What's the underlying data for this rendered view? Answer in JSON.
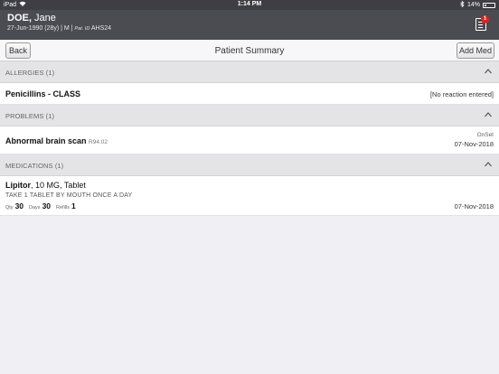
{
  "status_bar": {
    "carrier": "iPad",
    "time": "1:14 PM",
    "battery": "14%",
    "wifi_icon": "wifi-icon",
    "bluetooth_icon": "bluetooth-icon"
  },
  "patient": {
    "last_name": "DOE,",
    "first_name": "Jane",
    "dob_age": "27-Jun-1990 (28y)",
    "sex": "M",
    "pat_id_label": "Pat. ID",
    "pat_id": "AHS24",
    "badge_count": "1"
  },
  "toolbar": {
    "back_label": "Back",
    "title": "Patient Summary",
    "add_label": "Add Med"
  },
  "allergies": {
    "header": "ALLERGIES (1)",
    "items": [
      {
        "name": "Penicillins - CLASS",
        "reaction": "[No reaction entered]"
      }
    ]
  },
  "problems": {
    "header": "PROBLEMS (1)",
    "items": [
      {
        "name": "Abnormal brain scan",
        "code": "R94.02",
        "onset_label": "OnSet",
        "onset_date": "07-Nov-2018"
      }
    ]
  },
  "medications": {
    "header": "MEDICATIONS (1)",
    "items": [
      {
        "name": "Lipitor",
        "detail": ", 10 MG, Tablet",
        "sig": "TAKE 1 TABLET BY MOUTH ONCE A DAY",
        "qty_label": "Qty",
        "qty": "30",
        "days_label": "Days",
        "days": "30",
        "refills_label": "Refills",
        "refills": "1",
        "date": "07-Nov-2018"
      }
    ]
  },
  "colors": {
    "status_bar": "#3e3e44",
    "patient_header": "#4b4b52",
    "section_header": "#e4e4e6",
    "background": "#efeff4",
    "badge": "#e02020"
  }
}
